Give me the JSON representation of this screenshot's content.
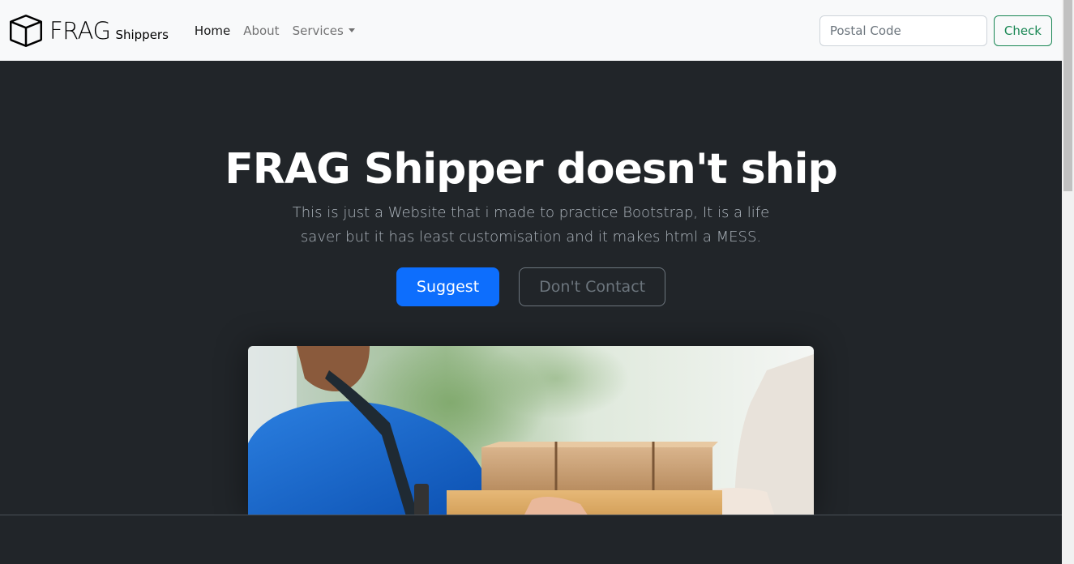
{
  "navbar": {
    "brand_icon": "box-icon",
    "brand_name": "FRAG",
    "brand_sub": "Shippers",
    "links": [
      {
        "label": "Home",
        "active": true
      },
      {
        "label": "About",
        "active": false
      },
      {
        "label": "Services",
        "active": false,
        "dropdown": true
      }
    ],
    "postal_placeholder": "Postal Code",
    "check_label": "Check"
  },
  "hero": {
    "title": "FRAG Shipper doesn't ship",
    "text": "This is just a Website that i made to practice Bootstrap, It is a life saver but it has least customisation and it makes html a MESS.",
    "primary_button": "Suggest",
    "secondary_button": "Don't Contact"
  },
  "colors": {
    "dark_bg": "#212529",
    "navbar_bg": "#f8f9fa",
    "primary": "#0d6efd",
    "success": "#198754",
    "secondary": "#6c757d"
  }
}
